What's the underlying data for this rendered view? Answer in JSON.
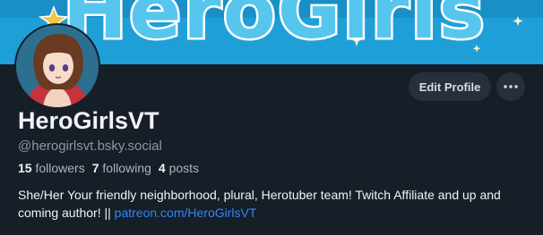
{
  "banner": {
    "title": "HeroGirls",
    "colors": {
      "sky": "#1f9fd8",
      "text_fill": "#56c6ef",
      "star": "#f5c542"
    }
  },
  "profile": {
    "display_name": "HeroGirlsVT",
    "handle": "@herogirlsvt.bsky.social",
    "avatar_icon": "anime-girl-avatar"
  },
  "actions": {
    "edit_label": "Edit Profile",
    "more_icon": "ellipsis-icon"
  },
  "stats": {
    "followers_count": "15",
    "followers_label": "followers",
    "following_count": "7",
    "following_label": "following",
    "posts_count": "4",
    "posts_label": "posts"
  },
  "bio": {
    "text": "She/Her Your friendly neighborhood, plural, Herotuber team! Twitch Affiliate and up and coming author! || ",
    "link_text": "patreon.com/HeroGirlsVT"
  },
  "colors": {
    "background": "#161e27",
    "button_bg": "#26303d",
    "link": "#2f86ff",
    "muted_text": "#8a97a6"
  }
}
